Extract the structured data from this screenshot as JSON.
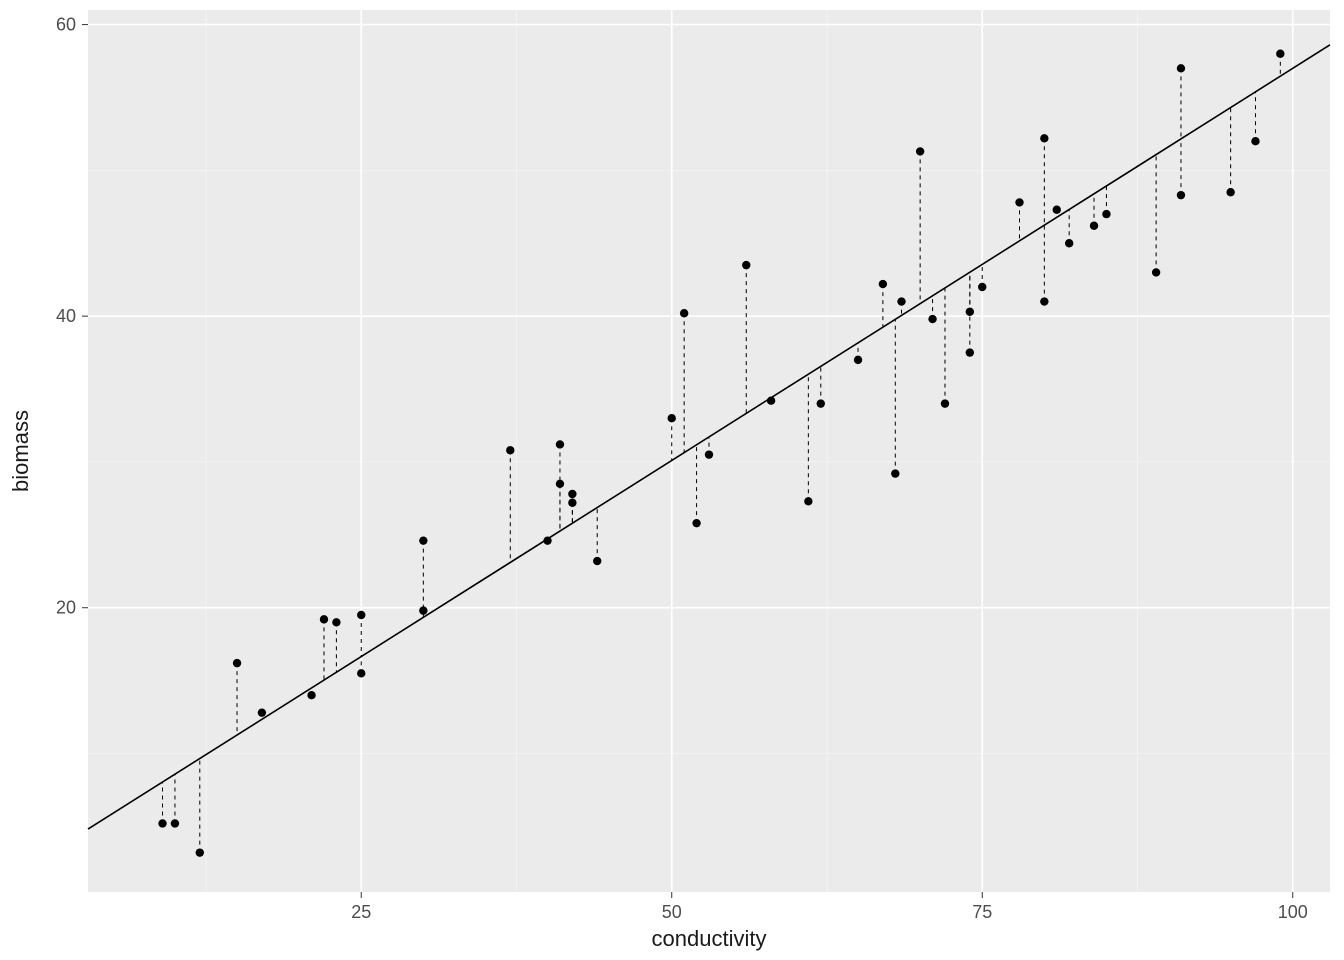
{
  "chart_data": {
    "type": "scatter",
    "xlabel": "conductivity",
    "ylabel": "biomass",
    "title": "",
    "xlim": [
      3,
      103
    ],
    "ylim": [
      0.5,
      61
    ],
    "x_ticks": [
      25,
      50,
      75,
      100
    ],
    "y_ticks": [
      20,
      40,
      60
    ],
    "x_minor": [
      12.5,
      37.5,
      62.5,
      87.5
    ],
    "y_minor": [
      10,
      30,
      50
    ],
    "regression": {
      "slope": 0.538,
      "intercept": 3.2
    },
    "points": [
      {
        "x": 9,
        "y": 5.2
      },
      {
        "x": 10,
        "y": 5.2
      },
      {
        "x": 12,
        "y": 3.2
      },
      {
        "x": 15,
        "y": 16.2
      },
      {
        "x": 17,
        "y": 12.8
      },
      {
        "x": 21,
        "y": 14.0
      },
      {
        "x": 22,
        "y": 19.2
      },
      {
        "x": 23,
        "y": 19.0
      },
      {
        "x": 25,
        "y": 15.5
      },
      {
        "x": 25,
        "y": 19.5
      },
      {
        "x": 30,
        "y": 19.8
      },
      {
        "x": 30,
        "y": 24.6
      },
      {
        "x": 37,
        "y": 30.8
      },
      {
        "x": 40,
        "y": 24.6
      },
      {
        "x": 41,
        "y": 31.2
      },
      {
        "x": 41,
        "y": 28.5
      },
      {
        "x": 42,
        "y": 27.2
      },
      {
        "x": 42,
        "y": 27.8
      },
      {
        "x": 44,
        "y": 23.2
      },
      {
        "x": 50,
        "y": 33.0
      },
      {
        "x": 51,
        "y": 40.2
      },
      {
        "x": 52,
        "y": 25.8
      },
      {
        "x": 53,
        "y": 30.5
      },
      {
        "x": 56,
        "y": 43.5
      },
      {
        "x": 58,
        "y": 34.2
      },
      {
        "x": 61,
        "y": 27.3
      },
      {
        "x": 62,
        "y": 34.0
      },
      {
        "x": 65,
        "y": 37.0
      },
      {
        "x": 67,
        "y": 42.2
      },
      {
        "x": 68,
        "y": 29.2
      },
      {
        "x": 68.5,
        "y": 41.0
      },
      {
        "x": 70,
        "y": 51.3
      },
      {
        "x": 71,
        "y": 39.8
      },
      {
        "x": 72,
        "y": 34.0
      },
      {
        "x": 74,
        "y": 40.3
      },
      {
        "x": 74,
        "y": 37.5
      },
      {
        "x": 75,
        "y": 42.0
      },
      {
        "x": 78,
        "y": 47.8
      },
      {
        "x": 80,
        "y": 41.0
      },
      {
        "x": 80,
        "y": 52.2
      },
      {
        "x": 81,
        "y": 47.3
      },
      {
        "x": 82,
        "y": 45.0
      },
      {
        "x": 84,
        "y": 46.2
      },
      {
        "x": 85,
        "y": 47.0
      },
      {
        "x": 89,
        "y": 43.0
      },
      {
        "x": 91,
        "y": 48.3
      },
      {
        "x": 91,
        "y": 57.0
      },
      {
        "x": 95,
        "y": 48.5
      },
      {
        "x": 97,
        "y": 52.0
      },
      {
        "x": 99,
        "y": 58.0
      }
    ]
  }
}
